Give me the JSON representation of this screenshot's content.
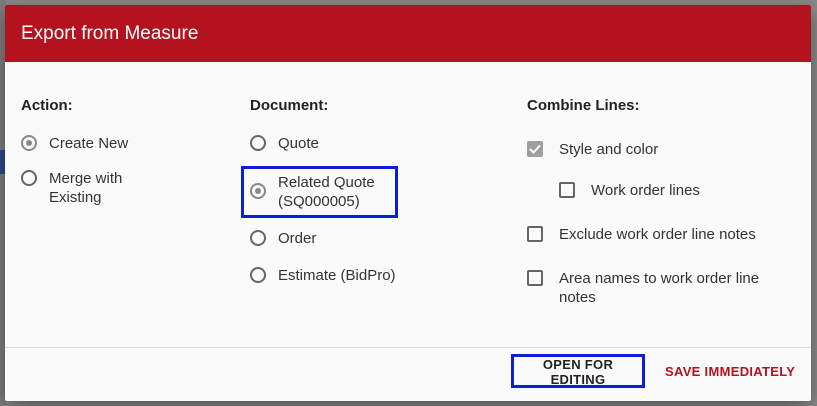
{
  "dialog": {
    "title": "Export from Measure",
    "accent_color": "#b3121f",
    "highlight_color": "#0a1fd6"
  },
  "action": {
    "title": "Action:",
    "options": [
      {
        "label": "Create New",
        "selected": true
      },
      {
        "label": "Merge with Existing",
        "selected": false
      }
    ]
  },
  "document": {
    "title": "Document:",
    "options": [
      {
        "label": "Quote",
        "selected": false
      },
      {
        "label": "Related Quote (SQ000005)",
        "selected": true
      },
      {
        "label": "Order",
        "selected": false
      },
      {
        "label": "Estimate (BidPro)",
        "selected": false
      }
    ]
  },
  "combine": {
    "title": "Combine Lines:",
    "options": [
      {
        "label": "Style and color",
        "checked": true,
        "icon": "checkmark-icon"
      },
      {
        "label": "Work order lines",
        "checked": false
      },
      {
        "label": "Exclude work order line notes",
        "checked": false
      },
      {
        "label": "Area names to work order line notes",
        "checked": false
      }
    ]
  },
  "footer": {
    "open_label": "OPEN FOR EDITING",
    "save_label": "SAVE IMMEDIATELY"
  }
}
